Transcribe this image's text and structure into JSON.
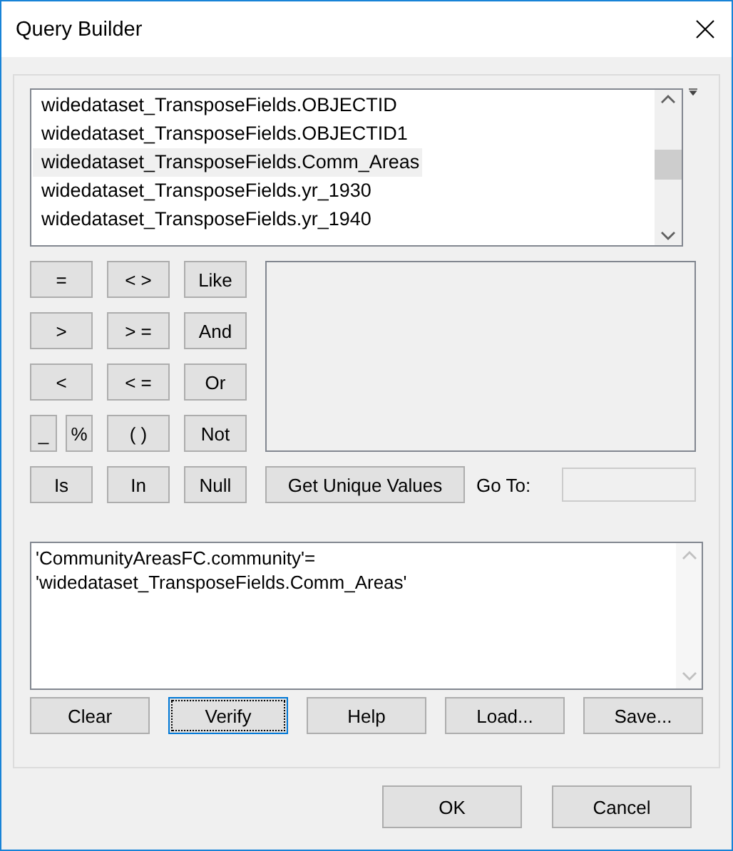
{
  "window": {
    "title": "Query Builder"
  },
  "field_list": {
    "items": [
      {
        "label": "widedataset_TransposeFields.OBJECTID",
        "selected": false
      },
      {
        "label": "widedataset_TransposeFields.OBJECTID1",
        "selected": false
      },
      {
        "label": "widedataset_TransposeFields.Comm_Areas",
        "selected": true
      },
      {
        "label": "widedataset_TransposeFields.yr_1930",
        "selected": false
      },
      {
        "label": "widedataset_TransposeFields.yr_1940",
        "selected": false
      }
    ]
  },
  "operators": [
    [
      {
        "label": "=",
        "kind": "full"
      },
      {
        "label": "< >",
        "kind": "full"
      },
      {
        "label": "Like",
        "kind": "full"
      }
    ],
    [
      {
        "label": ">",
        "kind": "full"
      },
      {
        "label": "> =",
        "kind": "full"
      },
      {
        "label": "And",
        "kind": "full"
      }
    ],
    [
      {
        "label": "<",
        "kind": "full"
      },
      {
        "label": "< =",
        "kind": "full"
      },
      {
        "label": "Or",
        "kind": "full"
      }
    ],
    [
      {
        "label": "_",
        "kind": "half"
      },
      {
        "label": "%",
        "kind": "half"
      },
      {
        "label": "( )",
        "kind": "full"
      },
      {
        "label": "Not",
        "kind": "full"
      }
    ],
    [
      {
        "label": "Is",
        "kind": "full"
      },
      {
        "label": "In",
        "kind": "full"
      },
      {
        "label": "Null",
        "kind": "full"
      }
    ]
  ],
  "unique_values_button": "Get Unique Values",
  "go_to": {
    "label": "Go To:"
  },
  "expression": {
    "value": "'CommunityAreasFC.community'=\n'widedataset_TransposeFields.Comm_Areas'"
  },
  "expression_buttons": [
    {
      "label": "Clear",
      "focused": false
    },
    {
      "label": "Verify",
      "focused": true
    },
    {
      "label": "Help",
      "focused": false
    },
    {
      "label": "Load...",
      "focused": false
    },
    {
      "label": "Save...",
      "focused": false
    }
  ],
  "dialog_buttons": [
    "OK",
    "Cancel"
  ]
}
